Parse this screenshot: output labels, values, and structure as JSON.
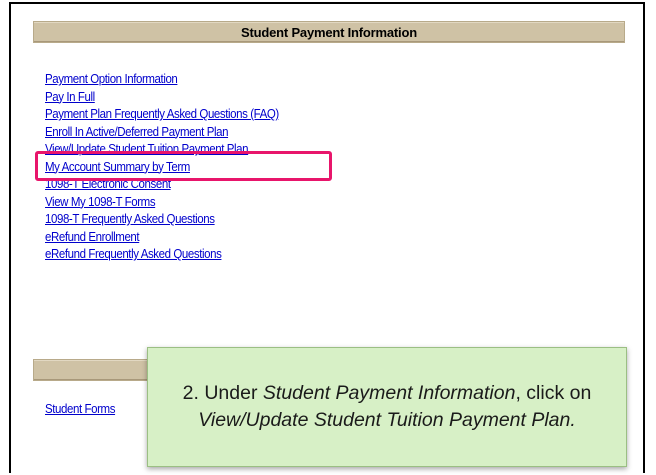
{
  "sections": {
    "payment_title": "Student Payment Information",
    "second_title": ""
  },
  "links": [
    "Payment Option Information",
    "Pay In Full",
    "Payment Plan Frequently Asked Questions (FAQ)",
    "Enroll In Active/Deferred Payment Plan",
    "View/Update Student Tuition Payment Plan",
    "My Account Summary by Term",
    "1098-T Electronic Consent",
    "View My 1098-T Forms",
    "1098-T Frequently Asked Questions",
    "eRefund Enrollment",
    "eRefund Frequently Asked Questions"
  ],
  "forms_link": "Student Forms",
  "callout": {
    "prefix": "2. Under ",
    "section_name": "Student Payment Information",
    "middle": ", click on ",
    "link_name": "View/Update Student Tuition Payment Plan.",
    "suffix": ""
  },
  "colors": {
    "link": "#0000cc",
    "section_bar": "#cfc2a5",
    "highlight": "#e8156b",
    "callout_bg": "#d7f0c6"
  }
}
